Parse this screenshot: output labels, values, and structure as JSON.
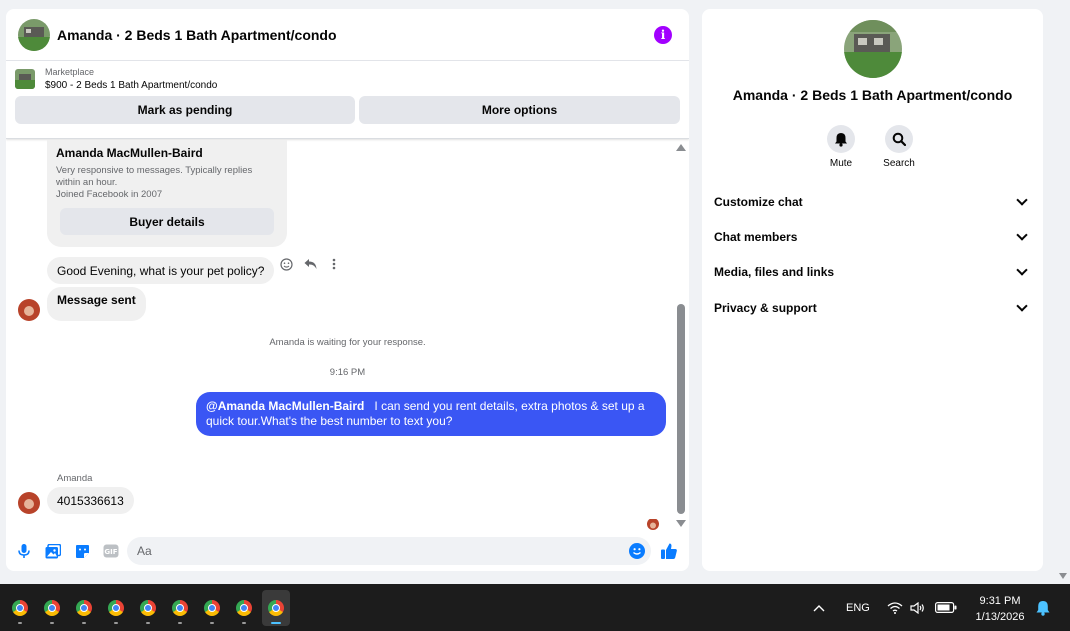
{
  "chat": {
    "title": "Amanda · 2 Beds 1 Bath Apartment/condo",
    "marketplace_label": "Marketplace",
    "listing_line": "$900 - 2 Beds 1 Bath Apartment/condo",
    "mark_pending_label": "Mark as pending",
    "more_options_label": "More options"
  },
  "profile_card": {
    "name": "Amanda MacMullen-Baird",
    "description": "Very responsive to messages. Typically replies within an hour.",
    "joined": "Joined Facebook in 2007",
    "buyer_details_label": "Buyer details"
  },
  "messages": {
    "incoming_1": "Good Evening, what is your pet policy?",
    "incoming_2": "Message sent",
    "waiting_note": "Amanda is waiting for your response.",
    "timestamp": "9:16 PM",
    "outgoing_mention": "@Amanda MacMullen-Baird",
    "outgoing_text": "I can send you rent details, extra photos & set up a quick tour.What's the best number to text you?",
    "sender_label": "Amanda",
    "incoming_3": "4015336613"
  },
  "composer": {
    "placeholder": "Aa"
  },
  "info_panel": {
    "title": "Amanda · 2 Beds 1 Bath Apartment/condo",
    "mute_label": "Mute",
    "search_label": "Search",
    "sections": [
      "Customize chat",
      "Chat members",
      "Media, files and links",
      "Privacy & support"
    ]
  },
  "taskbar": {
    "language": "ENG",
    "time": "9:31 PM",
    "date": "1/13/2026",
    "apps": [
      "chrome-icon",
      "chrome-icon",
      "chrome-icon",
      "chrome-icon",
      "chrome-icon",
      "chrome-icon",
      "chrome-icon",
      "chrome-icon",
      "chrome-icon"
    ]
  },
  "colors": {
    "accent_blue": "#0a7cff",
    "outgoing_bubble": "#3a56f4",
    "info_purple": "#a200ff"
  }
}
